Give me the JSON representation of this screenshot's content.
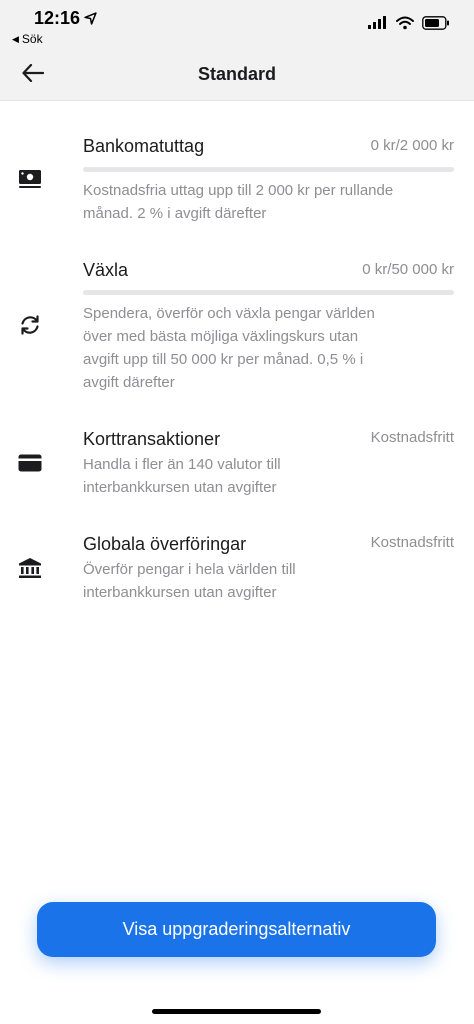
{
  "status_bar": {
    "time": "12:16",
    "back_app_label": "Sök"
  },
  "header": {
    "title": "Standard"
  },
  "features": [
    {
      "icon": "banknote-icon",
      "title": "Bankomatuttag",
      "limit": "0 kr/2 000 kr",
      "progress": 0,
      "description": "Kostnadsfria uttag upp till 2 000 kr per rullande månad. 2 %  i avgift därefter"
    },
    {
      "icon": "exchange-icon",
      "title": "Växla",
      "limit": "0 kr/50 000 kr",
      "progress": 0,
      "description": "Spendera, överför och växla pengar världen över med bästa möjliga växlingskurs utan avgift upp till 50 000 kr per månad. 0,5 %  i avgift därefter"
    },
    {
      "icon": "card-icon",
      "title": "Korttransaktioner",
      "limit": "Kostnadsfritt",
      "description": "Handla i fler än 140 valutor till interbankkursen utan avgifter"
    },
    {
      "icon": "bank-icon",
      "title": "Globala överföringar",
      "limit": "Kostnadsfritt",
      "description": "Överför pengar i hela världen till interbankkursen utan avgifter"
    }
  ],
  "cta": {
    "label": "Visa uppgraderingsalternativ"
  },
  "colors": {
    "accent": "#1a73e8",
    "secondary_text": "#8e8e93",
    "header_bg": "#f2f2f2"
  }
}
